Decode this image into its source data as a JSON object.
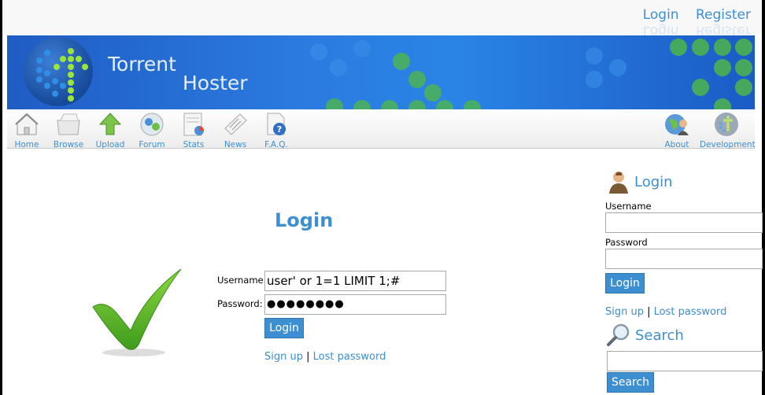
{
  "header": {
    "links": [
      "Login",
      "Register"
    ],
    "site_name_line1": "Torrent",
    "site_name_line2": "Hoster"
  },
  "nav": {
    "left_items": [
      {
        "label": "Home",
        "icon": "home-icon"
      },
      {
        "label": "Browse",
        "icon": "browse-icon"
      },
      {
        "label": "Upload",
        "icon": "upload-icon"
      },
      {
        "label": "Forum",
        "icon": "forum-icon"
      },
      {
        "label": "Stats",
        "icon": "stats-icon"
      },
      {
        "label": "News",
        "icon": "news-icon"
      },
      {
        "label": "F.A.Q.",
        "icon": "faq-icon"
      }
    ],
    "right_items": [
      {
        "label": "About",
        "icon": "about-icon"
      },
      {
        "label": "Development",
        "icon": "development-icon"
      }
    ]
  },
  "main": {
    "title": "Login",
    "username_label": "Username:",
    "username_value": "user' or 1=1 LIMIT 1;#",
    "password_label": "Password:",
    "password_value": "●●●●●●●●",
    "login_button": "Login",
    "signup_link": "Sign up",
    "separator": "|",
    "lost_password_link": "Lost password"
  },
  "sidebar": {
    "login_heading": "Login",
    "username_label": "Username",
    "password_label": "Password",
    "login_button": "Login",
    "signup_link": "Sign up",
    "separator": "|",
    "lost_password_link": "Lost password",
    "search_heading": "Search",
    "search_button": "Search"
  },
  "colors": {
    "accent": "#3d8fd1",
    "banner_blue": "#2a7be0",
    "check_green": "#5cb82a"
  }
}
